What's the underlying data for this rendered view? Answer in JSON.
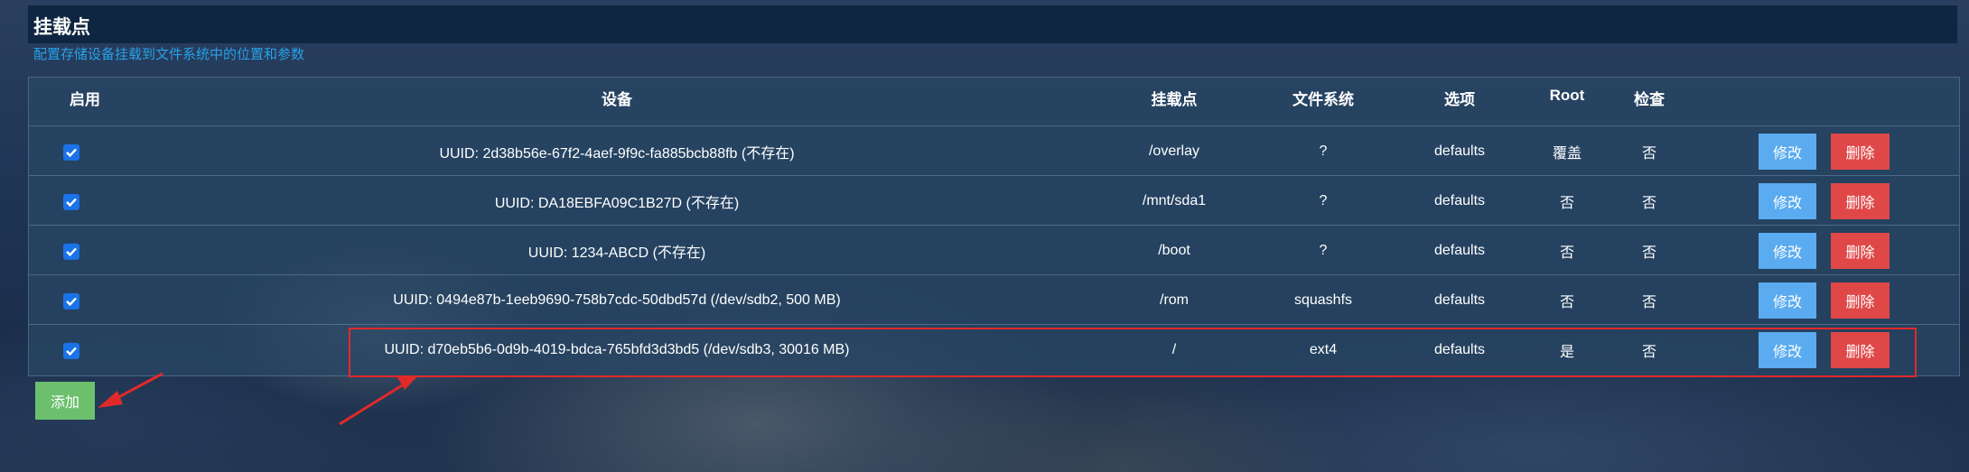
{
  "header": {
    "title": "挂载点",
    "subtitle": "配置存储设备挂载到文件系统中的位置和参数"
  },
  "table": {
    "columns": [
      "启用",
      "设备",
      "挂载点",
      "文件系统",
      "选项",
      "Root",
      "检查"
    ],
    "rows": [
      {
        "enabled": true,
        "device": "UUID: 2d38b56e-67f2-4aef-9f9c-fa885bcb88fb (不存在)",
        "mountpoint": "/overlay",
        "fs": "?",
        "options": "defaults",
        "root": "覆盖",
        "check": "否",
        "edit_label": "修改",
        "delete_label": "删除"
      },
      {
        "enabled": true,
        "device": "UUID: DA18EBFA09C1B27D (不存在)",
        "mountpoint": "/mnt/sda1",
        "fs": "?",
        "options": "defaults",
        "root": "否",
        "check": "否",
        "edit_label": "修改",
        "delete_label": "删除"
      },
      {
        "enabled": true,
        "device": "UUID: 1234-ABCD (不存在)",
        "mountpoint": "/boot",
        "fs": "?",
        "options": "defaults",
        "root": "否",
        "check": "否",
        "edit_label": "修改",
        "delete_label": "删除"
      },
      {
        "enabled": true,
        "device": "UUID: 0494e87b-1eeb9690-758b7cdc-50dbd57d (/dev/sdb2, 500 MB)",
        "mountpoint": "/rom",
        "fs": "squashfs",
        "options": "defaults",
        "root": "否",
        "check": "否",
        "edit_label": "修改",
        "delete_label": "删除"
      },
      {
        "enabled": true,
        "device": "UUID: d70eb5b6-0d9b-4019-bdca-765bfd3d3bd5 (/dev/sdb3, 30016 MB)",
        "mountpoint": "/",
        "fs": "ext4",
        "options": "defaults",
        "root": "是",
        "check": "否",
        "edit_label": "修改",
        "delete_label": "删除"
      }
    ]
  },
  "add_button_label": "添加",
  "colors": {
    "edit_button": "#5aabf0",
    "delete_button": "#e04848",
    "add_button": "#6cc06d",
    "subtitle": "#27a2e8",
    "annotation": "#e02a2a"
  },
  "icons": {
    "checkbox": "check-icon",
    "annotation": "arrow-icon"
  }
}
